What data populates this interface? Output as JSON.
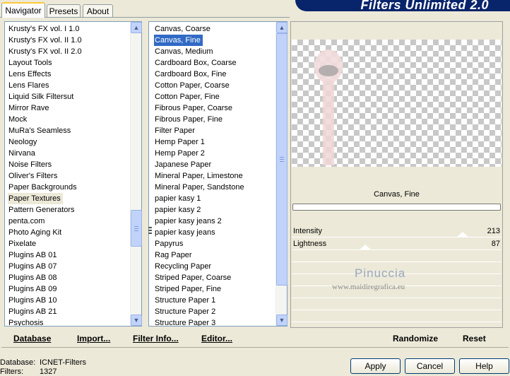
{
  "tabs": [
    {
      "label": "Navigator",
      "active": true
    },
    {
      "label": "Presets",
      "active": false
    },
    {
      "label": "About",
      "active": false
    }
  ],
  "banner_title": "Filters Unlimited 2.0",
  "categories": [
    "Krusty's FX vol. I 1.0",
    "Krusty's FX vol. II 1.0",
    "Krusty's FX vol. II 2.0",
    "Layout Tools",
    "Lens Effects",
    "Lens Flares",
    "Liquid Silk Filtersut",
    "Mirror Rave",
    "Mock",
    "MuRa's Seamless",
    "Neology",
    "Nirvana",
    "Noise Filters",
    "Oliver's Filters",
    "Paper Backgrounds",
    "Paper Textures",
    "Pattern Generators",
    "penta.com",
    "Photo Aging Kit",
    "Pixelate",
    "Plugins AB 01",
    "Plugins AB 07",
    "Plugins AB 08",
    "Plugins AB 09",
    "Plugins AB 10",
    "Plugins AB 21",
    "Psychosis"
  ],
  "selected_category": "Paper Textures",
  "filters": [
    "Canvas, Coarse",
    "Canvas, Fine",
    "Canvas, Medium",
    "Cardboard Box, Coarse",
    "Cardboard Box, Fine",
    "Cotton Paper, Coarse",
    "Cotton Paper, Fine",
    "Fibrous Paper, Coarse",
    "Fibrous Paper, Fine",
    "Filter Paper",
    "Hemp Paper 1",
    "Hemp Paper 2",
    "Japanese Paper",
    "Mineral Paper, Limestone",
    "Mineral Paper, Sandstone",
    "papier kasy 1",
    "papier kasy 2",
    "papier kasy jeans 2",
    "papier kasy jeans",
    "Papyrus",
    "Rag Paper",
    "Recycling Paper",
    "Striped Paper, Coarse",
    "Striped Paper, Fine",
    "Structure Paper 1",
    "Structure Paper 2",
    "Structure Paper 3"
  ],
  "selected_filter": "Canvas, Fine",
  "preview_filter_name": "Canvas, Fine",
  "params": [
    {
      "label": "Intensity",
      "value": "213",
      "level": 0.835
    },
    {
      "label": "Lightness",
      "value": "87",
      "level": 0.341
    }
  ],
  "watermark": {
    "name": "Pinuccia",
    "site": "www.maidiregrafica.eu"
  },
  "left_buttons": {
    "database": "Database",
    "import": "Import...",
    "filter_info": "Filter Info...",
    "editor": "Editor..."
  },
  "right_buttons": {
    "randomize": "Randomize",
    "reset": "Reset"
  },
  "status": {
    "database_label": "Database:",
    "database_value": "ICNET-Filters",
    "filters_label": "Filters:",
    "filters_value": "1327"
  },
  "dialog_buttons": {
    "apply": "Apply",
    "cancel": "Cancel",
    "help": "Help"
  },
  "colors": {
    "banner": "#08246b",
    "selection": "#316ac5",
    "tab_highlight": "#ffc83c"
  }
}
